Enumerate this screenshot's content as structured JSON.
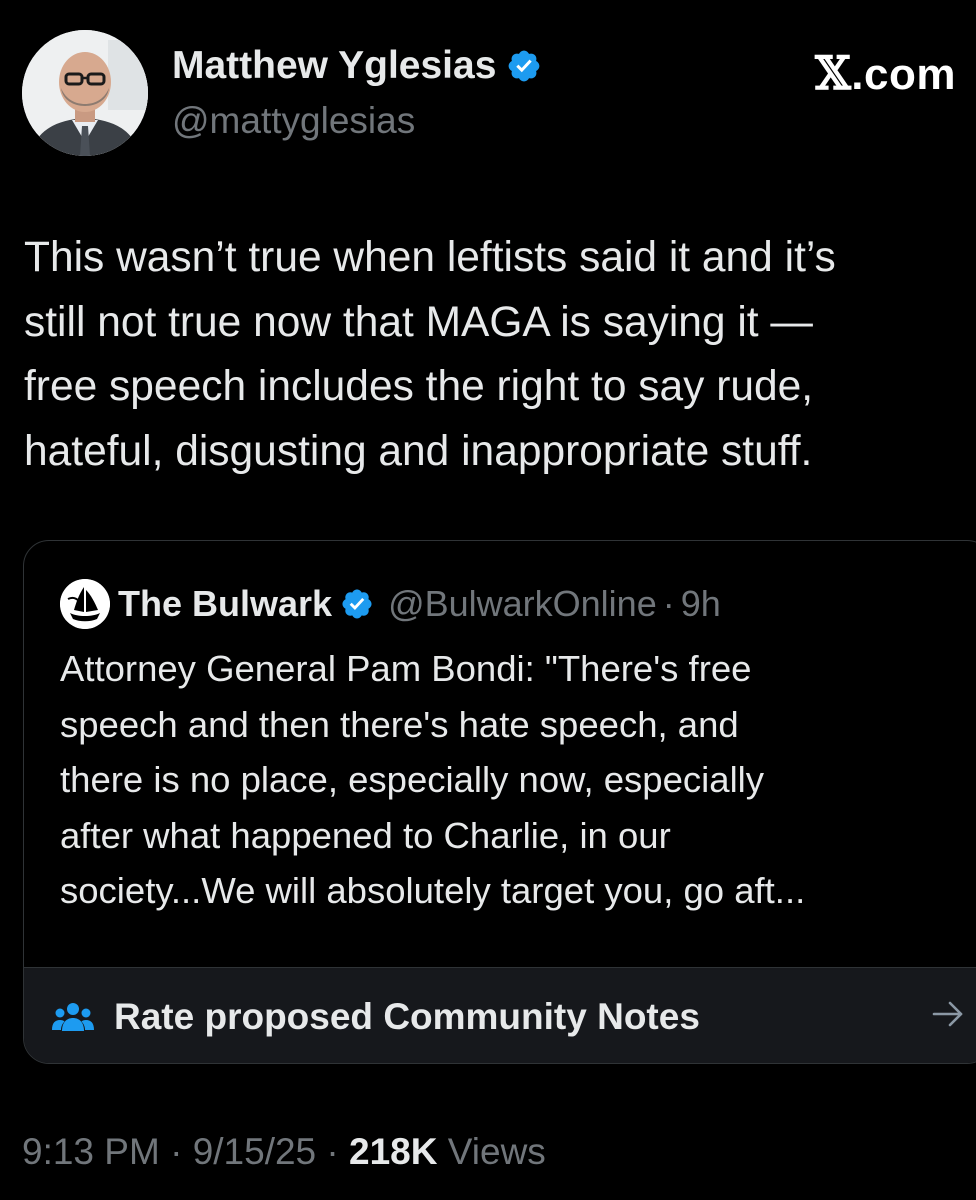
{
  "author": {
    "name": "Matthew Yglesias",
    "handle": "@mattyglesias",
    "verified": true
  },
  "brand": {
    "x_glyph": "𝕏",
    "suffix": ".com"
  },
  "tweet": {
    "text": "This wasn’t true when leftists said it and it’s\nstill not true now that MAGA is saying it —\nfree speech includes the right to say rude,\nhateful, disgusting and inappropriate stuff."
  },
  "quote": {
    "name": "The Bulwark",
    "handle": "@BulwarkOnline",
    "dot": "·",
    "time": "9h",
    "verified": true,
    "text": "Attorney General Pam Bondi: \"There's free\nspeech and then there's hate speech, and\nthere is no place, especially now, especially\nafter what happened to Charlie, in our\nsociety...We will absolutely target you, go aft..."
  },
  "community_notes": {
    "label": "Rate proposed Community Notes"
  },
  "meta": {
    "time": "9:13 PM",
    "sep1": " · ",
    "date": "9/15/25",
    "sep2": " · ",
    "views_count": "218K",
    "views_label": " Views"
  },
  "colors": {
    "background": "#000000",
    "primary_text": "#e7e9ea",
    "secondary_text": "#71767b",
    "verified_blue": "#1d9bf0",
    "border": "#2f3336"
  }
}
